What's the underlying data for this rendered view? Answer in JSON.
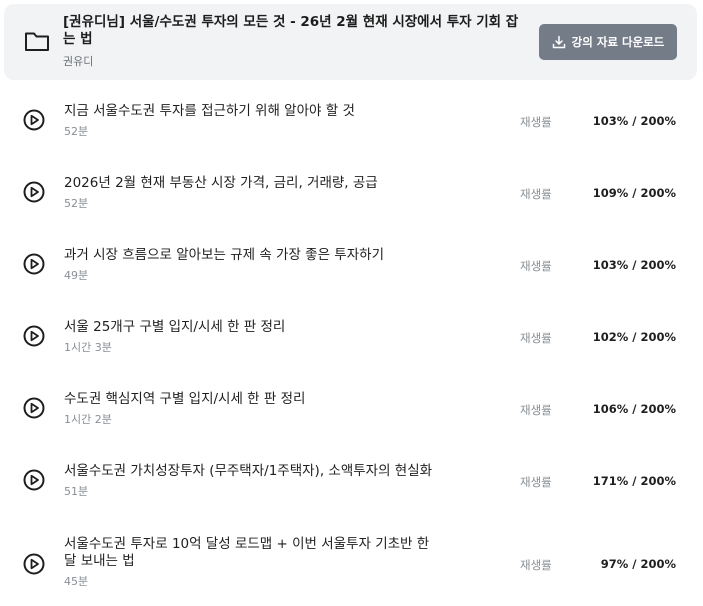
{
  "course": {
    "title": "[권유디님] 서울/수도권 투자의 모든 것 - 26년 2월 현재 시장에서 투자 기회 잡는 법",
    "author": "권유디",
    "download_label": "강의 자료 다운로드"
  },
  "rate_label": "재생률",
  "lessons": [
    {
      "title": "지금 서울수도권 투자를 접근하기 위해 알아야 할 것",
      "duration": "52분",
      "rate": "103% / 200%"
    },
    {
      "title": "2026년 2월 현재 부동산 시장 가격, 금리, 거래량, 공급",
      "duration": "52분",
      "rate": "109% / 200%"
    },
    {
      "title": "과거 시장 흐름으로 알아보는 규제 속 가장 좋은 투자하기",
      "duration": "49분",
      "rate": "103% / 200%"
    },
    {
      "title": "서울 25개구 구별 입지/시세 한 판 정리",
      "duration": "1시간 3분",
      "rate": "102% / 200%"
    },
    {
      "title": "수도권 핵심지역 구별 입지/시세 한 판 정리",
      "duration": "1시간 2분",
      "rate": "106% / 200%"
    },
    {
      "title": "서울수도권 가치성장투자 (무주택자/1주택자), 소액투자의 현실화",
      "duration": "51분",
      "rate": "171% / 200%"
    },
    {
      "title": "서울수도권 투자로 10억 달성 로드맵 + 이번 서울투자 기초반 한 달 보내는 법",
      "duration": "45분",
      "rate": "97% / 200%"
    }
  ]
}
